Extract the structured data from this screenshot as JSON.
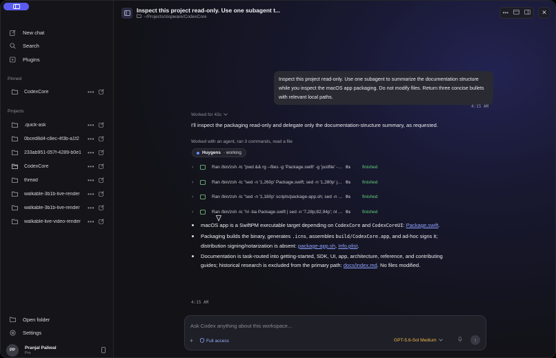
{
  "sidebar": {
    "nav": [
      {
        "label": "New chat",
        "icon": "new-chat-icon"
      },
      {
        "label": "Search",
        "icon": "search-icon"
      },
      {
        "label": "Plugins",
        "icon": "plugins-icon"
      }
    ],
    "pinned_label": "Pinned",
    "pinned": [
      {
        "name": "CodexCore"
      }
    ],
    "projects_label": "Projects",
    "projects": [
      {
        "name": ".quick-ask"
      },
      {
        "name": "0bced8d4-c8ec-4f3b-a1f2"
      },
      {
        "name": "233ab951-057f-4289-b0e1"
      },
      {
        "name": "CodexCore"
      },
      {
        "name": "thread"
      },
      {
        "name": "walkable-3b1b-live-render"
      },
      {
        "name": "walkable-3b1b-live-render"
      },
      {
        "name": "walkable-live-video-render"
      }
    ],
    "open_folder": "Open folder",
    "settings": "Settings",
    "user": {
      "initials": "PP",
      "name": "Pranjal Paliwal",
      "plan": "Pro"
    }
  },
  "header": {
    "title": "Inspect this project read-only. Use one subagent t...",
    "path": "~/Projects/slopware/CodexCore"
  },
  "user_message": {
    "text": "Inspect this project read-only. Use one subagent to summarize the documentation structure while you inspect the macOS app packaging. Do not modify files. Return three concise bullets with relevant local paths.",
    "time": "4:15 AM"
  },
  "reply": {
    "worked_for": "Worked for 43s",
    "intro": "I'll inspect the packaging read-only and delegate only the documentation-structure summary, as requested.",
    "summary": "Worked with an agent, ran 3 commands, read a file",
    "agent": {
      "name": "Huygens",
      "status": "· working"
    },
    "commands": [
      {
        "text": "Ran /bin/zsh -lc \"pwd && rg --files -g 'Package.swift' -g 'justfile' -g '*.entitlements'\"",
        "duration": "0s",
        "status": "finished"
      },
      {
        "text": "Ran /bin/zsh -lc \"sed -n '1,260p' Package.swift; sed -n '1,280p' justfile; plutil -p Info.plist\"",
        "duration": "0s",
        "status": "finished"
      },
      {
        "text": "Ran /bin/zsh -lc \"sed -n '1,180p' scripts/package-app.sh; sed -n '1,120p' Sources/CodexCore\"",
        "duration": "0s",
        "status": "finished"
      },
      {
        "text": "Ran /bin/zsh -lc \"nl -ba Package.swift | sed -n '7,28p;82,94p'; nl -ba scripts/package-app.sh\"",
        "duration": "0s",
        "status": "finished"
      }
    ],
    "bullets": {
      "b1_pre": "macOS app is a SwiftPM executable target depending on ",
      "b1_code1": "CodexCore",
      "b1_mid": " and ",
      "b1_code2": "CodexCoreUI",
      "b1_colon": ":",
      "b1_link": "Package.swift",
      "b1_end": ".",
      "b2_pre": "Packaging builds the binary, generates ",
      "b2_code1": ".icns",
      "b2_mid1": ", assembles ",
      "b2_code2": "build/CodexCore.app",
      "b2_mid2": ", and ad-hoc signs it; distribution signing/notarization is absent: ",
      "b2_link1": "package-app.sh",
      "b2_comma": ", ",
      "b2_link2": "Info.plist",
      "b2_end": ".",
      "b3_pre": "Documentation is task-routed into getting-started, SDK, UI, app, architecture, reference, and contributing guides; historical research is excluded from the primary path: ",
      "b3_link": "docs/index.md",
      "b3_end": ". No files modified."
    },
    "time": "4:15 AM"
  },
  "composer": {
    "placeholder": "Ask Codex anything about this workspace...",
    "access": "Full access",
    "model": "GPT-5.6-Sol Medium"
  },
  "colors": {
    "accent": "#5a5cf0",
    "link": "#8ea2ff",
    "finished": "#5fd27a",
    "model": "#f1b84a"
  }
}
